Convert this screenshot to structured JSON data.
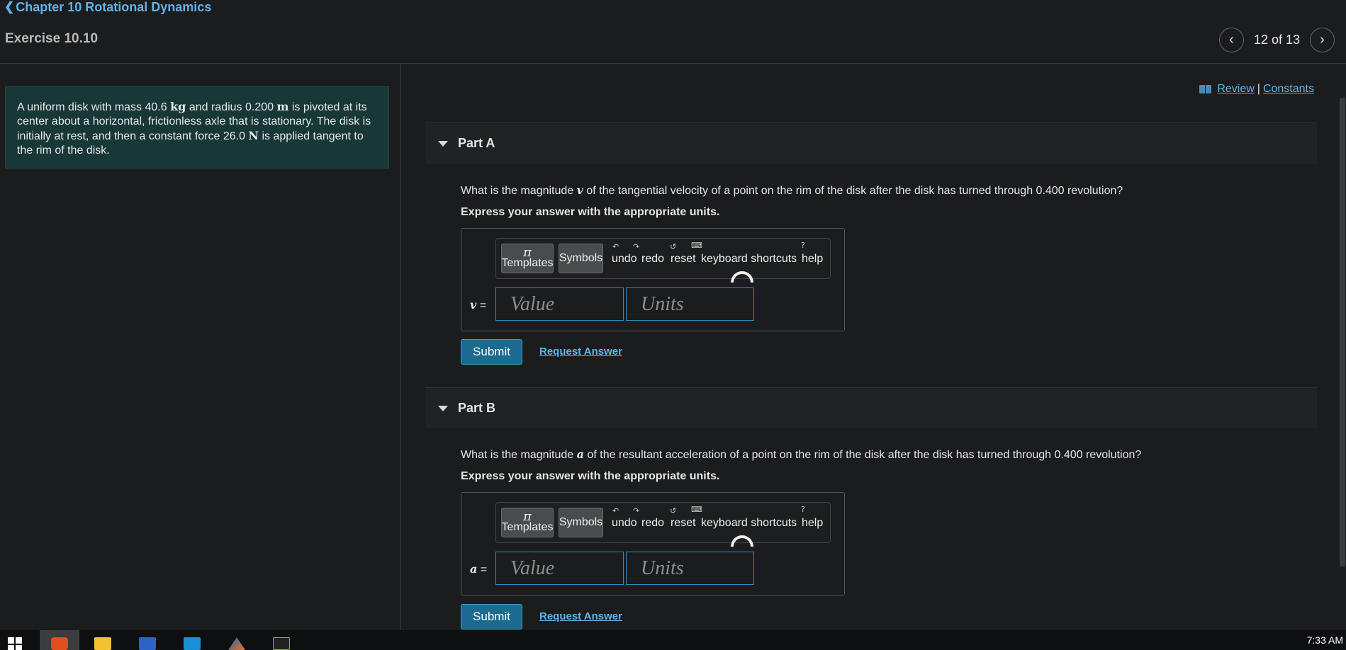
{
  "header": {
    "chapter_link": "Chapter 10 Rotational Dynamics",
    "exercise_title": "Exercise 10.10",
    "pager": {
      "position": "12 of 13"
    }
  },
  "problem": {
    "text_parts": [
      "A uniform disk with mass 40.6 ",
      "kg",
      " and radius 0.200 ",
      "m",
      " is pivoted at its center about a horizontal, frictionless axle that is stationary. The disk is initially at rest, and then a constant force 26.0 ",
      "N",
      " is applied tangent to the rim of the disk."
    ]
  },
  "links": {
    "review": "Review",
    "separator": "|",
    "constants": "Constants"
  },
  "toolbar": {
    "templates": "Templates",
    "symbols": "Symbols",
    "pi": "π",
    "undo": "undo",
    "redo": "redo",
    "reset": "reset",
    "shortcuts": "keyboard shortcuts",
    "help": "help"
  },
  "part_a": {
    "label": "Part A",
    "question_pre": "What is the magnitude ",
    "symbol": "v",
    "question_post": " of the tangential velocity of a point on the rim of the disk after the disk has turned through 0.400 revolution?",
    "instruction": "Express your answer with the appropriate units.",
    "var_eq": "=",
    "value_placeholder": "Value",
    "units_placeholder": "Units",
    "submit": "Submit",
    "request": "Request Answer"
  },
  "part_b": {
    "label": "Part B",
    "question_pre": "What is the magnitude ",
    "symbol": "a",
    "question_post": " of the resultant acceleration of a point on the rim of the disk after the disk has turned through 0.400 revolution?",
    "instruction": "Express your answer with the appropriate units.",
    "var_eq": "=",
    "value_placeholder": "Value",
    "units_placeholder": "Units",
    "submit": "Submit",
    "request": "Request Answer"
  },
  "taskbar": {
    "clock": "7:33 AM"
  },
  "colors": {
    "accent": "#5fb3e8",
    "submit_bg": "#1d6a8f",
    "problem_bg": "#183838"
  }
}
